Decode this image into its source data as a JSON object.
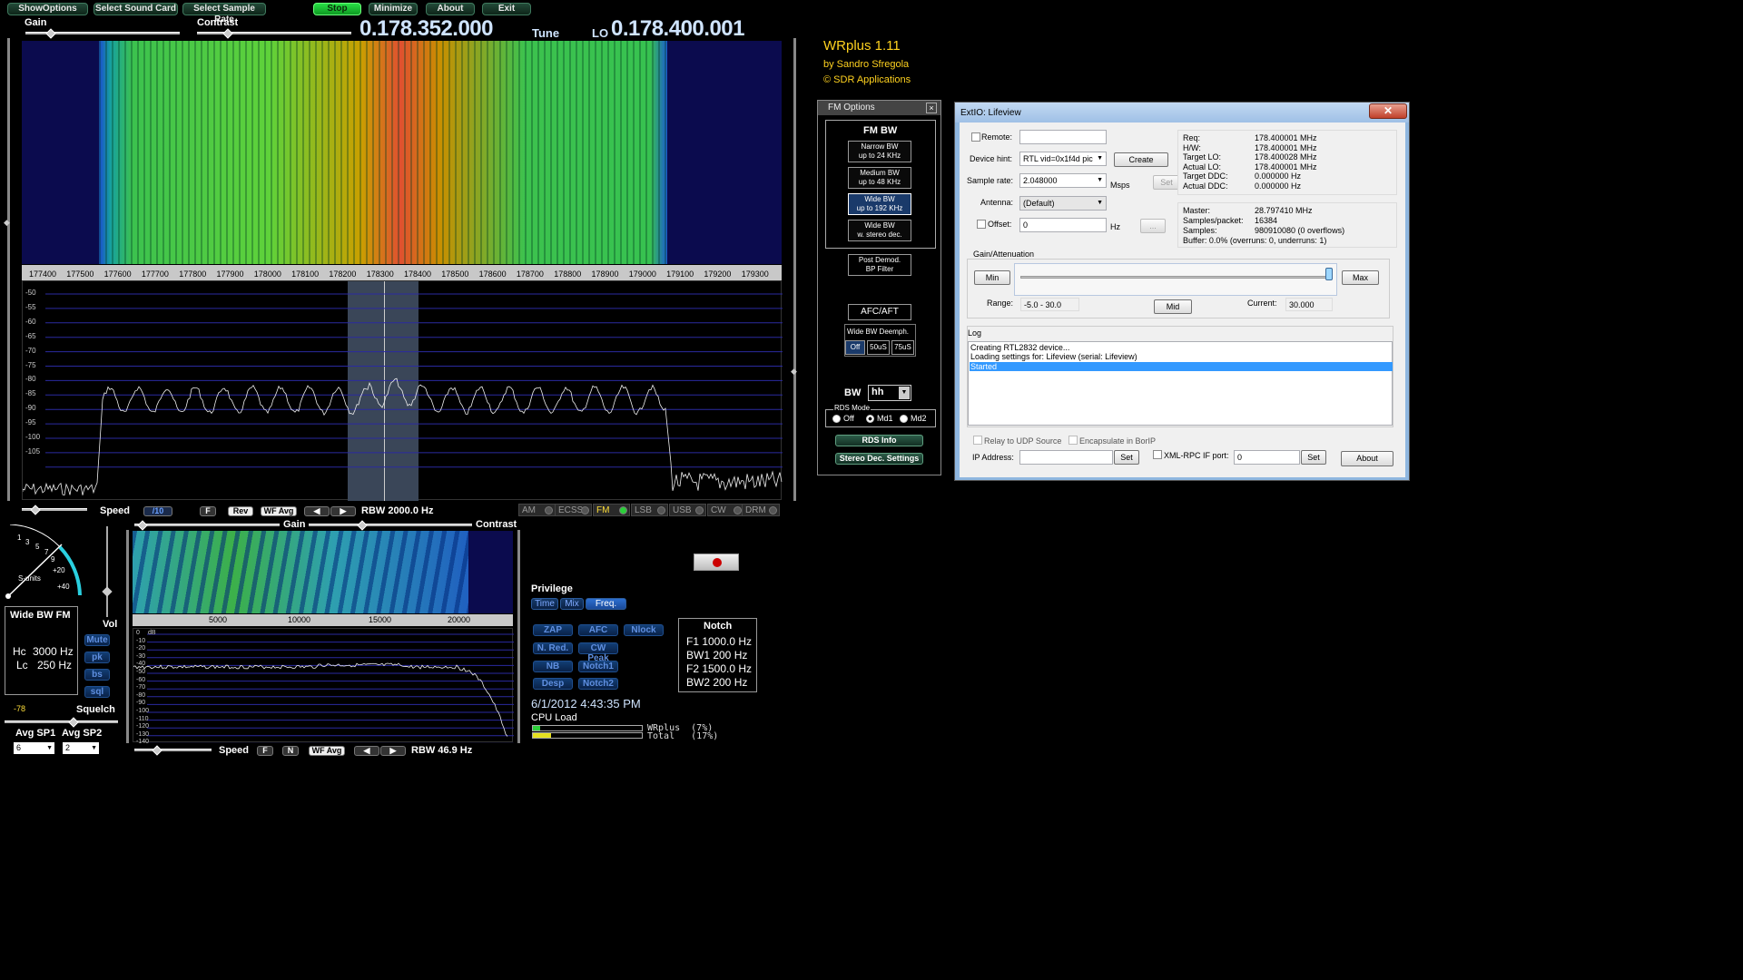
{
  "toolbar": {
    "show_options": "ShowOptions",
    "select_sound_card": "Select Sound Card",
    "select_sample_rate": "Select Sample Rate",
    "stop": "Stop",
    "minimize": "Minimize",
    "about": "About",
    "exit": "Exit"
  },
  "top": {
    "gain_label": "Gain",
    "contrast_label": "Contrast",
    "tune_freq": "0.178.352.000",
    "tune_label": "Tune",
    "lo_label": "LO",
    "lo_freq": "0.178.400.001"
  },
  "app": {
    "title": "WRplus 1.11",
    "author": "by Sandro Sfregola",
    "company": "© SDR Applications"
  },
  "main_spectrum": {
    "freq_ticks": [
      "177400",
      "177500",
      "177600",
      "177700",
      "177800",
      "177900",
      "178000",
      "178100",
      "178200",
      "178300",
      "178400",
      "178500",
      "178600",
      "178700",
      "178800",
      "178900",
      "179000",
      "179100",
      "179200",
      "179300"
    ],
    "db_ticks": [
      "-50",
      "-55",
      "-60",
      "-65",
      "-70",
      "-75",
      "-80",
      "-85",
      "-90",
      "-95",
      "-100",
      "-105"
    ],
    "speed_label": "Speed",
    "div_label": "/10",
    "f_label": "F",
    "rev_label": "Rev",
    "wfavg_label": "WF Avg",
    "rbw": "RBW 2000.0 Hz",
    "modes": [
      {
        "label": "AM",
        "active": false
      },
      {
        "label": "ECSS",
        "active": false
      },
      {
        "label": "FM",
        "active": true
      },
      {
        "label": "LSB",
        "active": false
      },
      {
        "label": "USB",
        "active": false
      },
      {
        "label": "CW",
        "active": false
      },
      {
        "label": "DRM",
        "active": false
      }
    ]
  },
  "smeter": {
    "ticks": [
      "1",
      "3",
      "5",
      "7",
      "9",
      "+20",
      "+40"
    ],
    "units": "S-units",
    "vol_label": "Vol"
  },
  "filter_box": {
    "title": "Wide BW FM",
    "hc_label": "Hc",
    "hc_value": "3000 Hz",
    "lc_label": "Lc",
    "lc_value": "250 Hz"
  },
  "side_buttons": [
    "Mute",
    "pk",
    "bs",
    "sql"
  ],
  "squelch": {
    "value": "-78",
    "label": "Squelch"
  },
  "avg": {
    "sp1_label": "Avg SP1",
    "sp1_value": "6",
    "sp2_label": "Avg SP2",
    "sp2_value": "2"
  },
  "audio_spectrum": {
    "gain_label": "Gain",
    "contrast_label": "Contrast",
    "freq_ticks": [
      "5000",
      "10000",
      "15000",
      "20000"
    ],
    "db_ticks": [
      "0",
      "-10",
      "-20",
      "-30",
      "-40",
      "-50",
      "-60",
      "-70",
      "-80",
      "-90",
      "-100",
      "-110",
      "-120",
      "-130",
      "-140"
    ],
    "db_unit": "dB",
    "speed_label": "Speed",
    "f_label": "F",
    "n_label": "N",
    "wfavg_label": "WF Avg",
    "rbw": "RBW 46.9 Hz"
  },
  "privilege": {
    "label": "Privilege",
    "tabs": [
      {
        "label": "Time",
        "active": false
      },
      {
        "label": "Mix",
        "active": false
      },
      {
        "label": "Freq.",
        "active": true
      }
    ]
  },
  "dsp_buttons": [
    "ZAP",
    "AFC",
    "Nlock",
    "N. Red.",
    "CW Peak",
    "NB",
    "Notch1",
    "Desp",
    "Notch2"
  ],
  "notch": {
    "title": "Notch",
    "f1": "F1 1000.0 Hz",
    "bw1": "BW1  200 Hz",
    "f2": "F2 1500.0 Hz",
    "bw2": "BW2  200 Hz"
  },
  "status": {
    "datetime": "6/1/2012 4:43:35 PM",
    "cpu_label": "CPU Load",
    "wrplus_load": "WRplus  (7%)",
    "total_load": "Total   (17%)",
    "wrplus_pct": 7,
    "total_pct": 17
  },
  "fm_options": {
    "title": "FM Options",
    "fm_bw_label": "FM BW",
    "bw_buttons": [
      {
        "l1": "Narrow BW",
        "l2": "up to 24 KHz",
        "selected": false
      },
      {
        "l1": "Medium BW",
        "l2": "up to 48 KHz",
        "selected": false
      },
      {
        "l1": "Wide BW",
        "l2": "up to 192 KHz",
        "selected": true
      },
      {
        "l1": "Wide BW",
        "l2": "w. stereo dec.",
        "selected": false
      }
    ],
    "post_demod_l1": "Post Demod.",
    "post_demod_l2": "BP Filter",
    "afc_aft": "AFC/AFT",
    "deemph_label": "Wide BW Deemph.",
    "deemph_opts": [
      "Off",
      "50uS",
      "75uS"
    ],
    "bw_label": "BW",
    "bw_value": "hh",
    "rds_mode_label": "RDS Mode",
    "rds_opts": [
      "Off",
      "Md1",
      "Md2"
    ],
    "rds_selected": "Md1",
    "rds_info": "RDS Info",
    "stereo_settings": "Stereo Dec. Settings"
  },
  "extio": {
    "title": "ExtIO: Lifeview",
    "remote_label": "Remote:",
    "device_hint_label": "Device hint:",
    "device_hint_value": "RTL vid=0x1f4d pic",
    "create": "Create",
    "sample_rate_label": "Sample rate:",
    "sample_rate_value": "2.048000",
    "msps": "Msps",
    "set": "Set",
    "antenna_label": "Antenna:",
    "antenna_value": "(Default)",
    "offset_label": "Offset:",
    "offset_value": "0",
    "hz": "Hz",
    "ellipsis": "...",
    "info1": [
      {
        "k": "Req:",
        "v": "178.400001 MHz"
      },
      {
        "k": "H/W:",
        "v": "178.400001 MHz"
      },
      {
        "k": "Target LO:",
        "v": "178.400028 MHz"
      },
      {
        "k": "Actual LO:",
        "v": "178.400001 MHz"
      },
      {
        "k": "Target DDC:",
        "v": "0.000000 Hz"
      },
      {
        "k": "Actual DDC:",
        "v": "0.000000 Hz"
      }
    ],
    "info2": [
      {
        "k": "Master:",
        "v": "28.797410 MHz"
      },
      {
        "k": "Samples/packet:",
        "v": "16384"
      },
      {
        "k": "Samples:",
        "v": "980910080 (0 overflows)"
      }
    ],
    "buffer": "Buffer: 0.0% (overruns: 0, underruns: 1)",
    "gain_group": "Gain/Attenuation",
    "min": "Min",
    "max": "Max",
    "mid": "Mid",
    "range_label": "Range:",
    "range_value": "-5.0 - 30.0",
    "current_label": "Current:",
    "current_value": "30.000",
    "log_label": "Log",
    "log_lines": [
      "Creating RTL2832 device...",
      "Loading settings for: Lifeview (serial: Lifeview)",
      "Started"
    ],
    "relay_udp": "Relay to UDP Source",
    "encapsulate": "Encapsulate in BorIP",
    "ip_label": "IP Address:",
    "xmlrpc_label": "XML-RPC IF port:",
    "xmlrpc_value": "0",
    "about": "About"
  }
}
